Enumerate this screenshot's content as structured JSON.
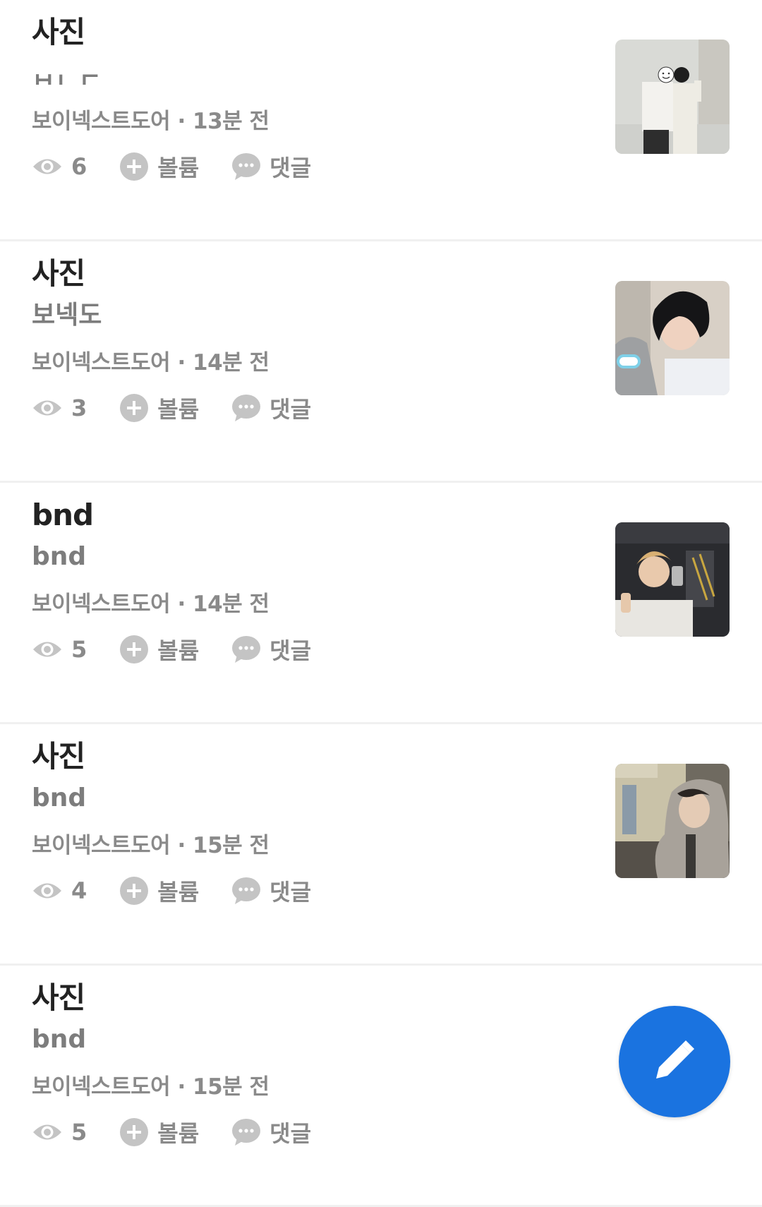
{
  "posts": [
    {
      "title": "사진",
      "subtitle": "ㅂㄴㄷ",
      "board": "보이넥스트도어",
      "time": "13분 전",
      "views": "6",
      "upvote_label": "볼륨",
      "comment_label": "댓글"
    },
    {
      "title": "사진",
      "subtitle": "보넥도",
      "board": "보이넥스트도어",
      "time": "14분 전",
      "views": "3",
      "upvote_label": "볼륨",
      "comment_label": "댓글"
    },
    {
      "title": "bnd",
      "subtitle": "bnd",
      "board": "보이넥스트도어",
      "time": "14분 전",
      "views": "5",
      "upvote_label": "볼륨",
      "comment_label": "댓글"
    },
    {
      "title": "사진",
      "subtitle": "bnd",
      "board": "보이넥스트도어",
      "time": "15분 전",
      "views": "4",
      "upvote_label": "볼륨",
      "comment_label": "댓글"
    },
    {
      "title": "사진",
      "subtitle": "bnd",
      "board": "보이넥스트도어",
      "time": "15분 전",
      "views": "5",
      "upvote_label": "볼륨",
      "comment_label": "댓글"
    }
  ],
  "meta_separator": "·",
  "icons": {
    "views": "eye-icon",
    "upvote": "plus-circle-icon",
    "comment": "chat-bubble-icon",
    "write": "pencil-icon"
  },
  "colors": {
    "accent": "#1a73e0",
    "title": "#222222",
    "muted": "#8a8a8a",
    "icon": "#c4c4c4"
  }
}
